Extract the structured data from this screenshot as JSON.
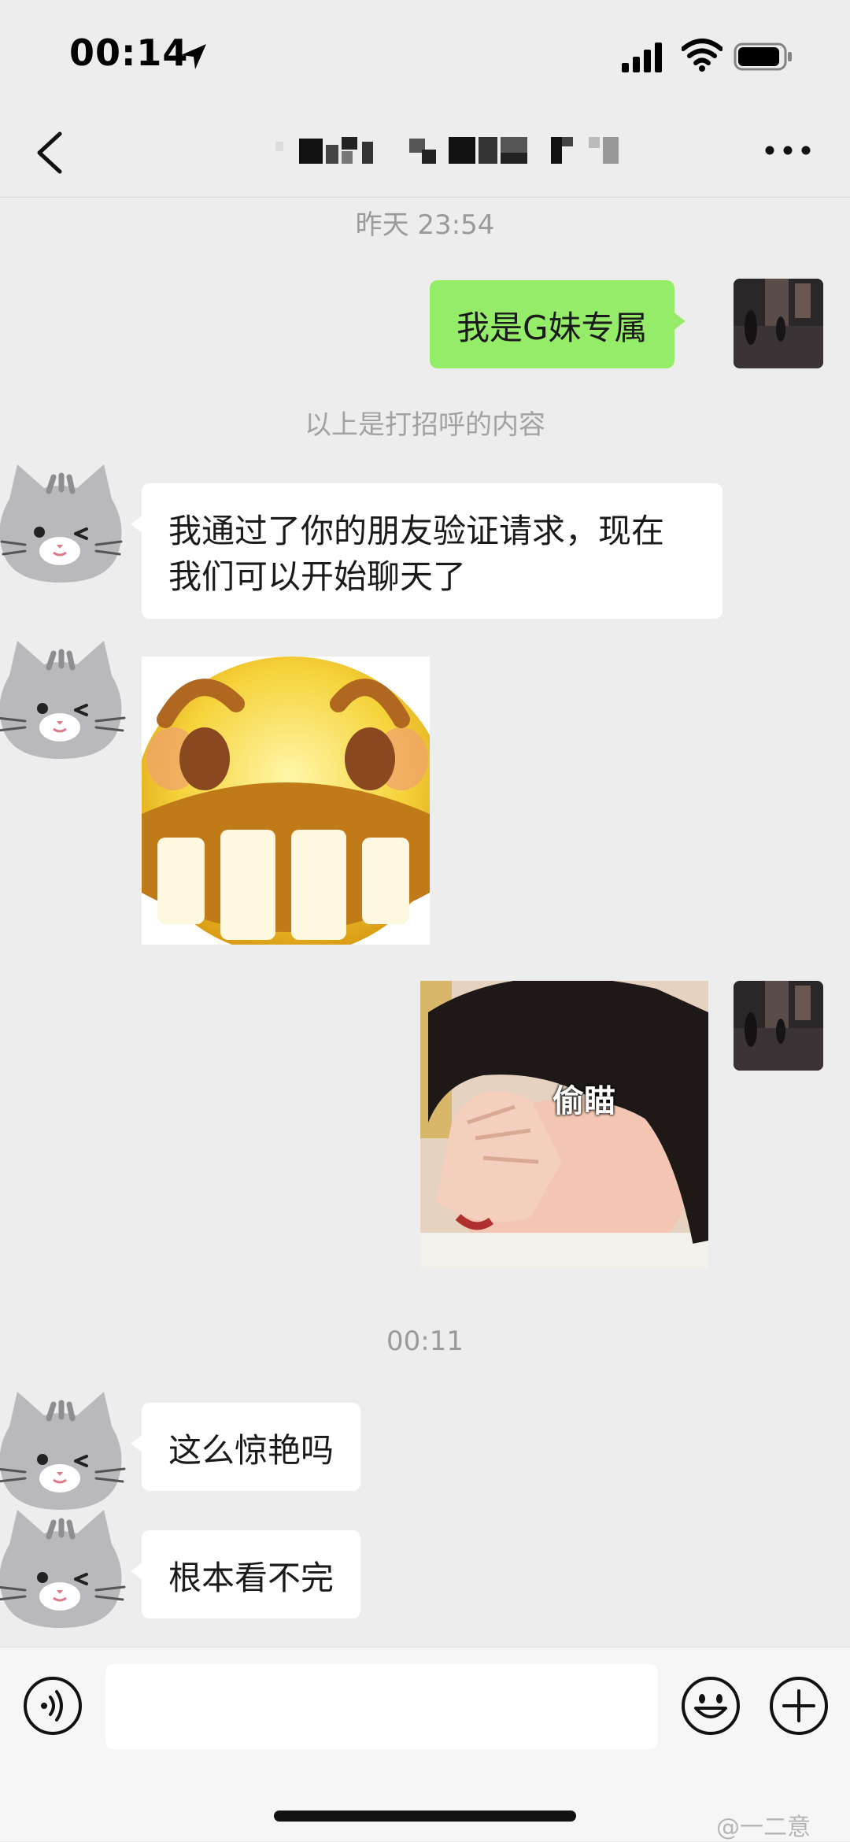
{
  "status_bar": {
    "time": "00:14"
  },
  "header": {
    "title": "",
    "back_icon": "chevron-left-icon",
    "more_icon": "ellipsis-icon"
  },
  "chat": {
    "timestamp_1": "昨天 23:54",
    "msg_self_1": "我是G妹专属",
    "system_notice": "以上是打招呼的内容",
    "msg_friend_1": "我通过了你的朋友验证请求，现在我们可以开始聊天了",
    "sticker_self_caption": "偷瞄",
    "timestamp_2": "00:11",
    "msg_friend_2": "这么惊艳吗",
    "msg_friend_3": "根本看不完"
  },
  "input_bar": {
    "placeholder": ""
  },
  "watermark": "@一二意",
  "colors": {
    "self_bubble": "#95ec69",
    "friend_bubble": "#ffffff",
    "background": "#ededed"
  }
}
